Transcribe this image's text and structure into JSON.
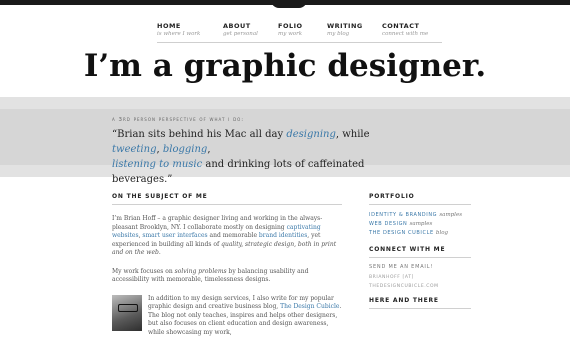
{
  "nav": [
    {
      "label": "HOME",
      "sub": "is where I work"
    },
    {
      "label": "ABOUT",
      "sub": "get personal"
    },
    {
      "label": "FOLIO",
      "sub": "my work"
    },
    {
      "label": "WRITING",
      "sub": "my blog"
    },
    {
      "label": "CONTACT",
      "sub": "connect with me"
    }
  ],
  "headline": "I’m a graphic designer.",
  "perspective_label": "A 3rd person perspective of what I do:",
  "quote": {
    "open": "“Brian sits behind his Mac all day ",
    "link1": "designing",
    "mid1": ", while ",
    "link2": "tweeting",
    "mid2": ", ",
    "link3": "blogging",
    "mid3": ",",
    "link4": "listening to music",
    "close": " and drinking lots of caffeinated beverages.”"
  },
  "main": {
    "section_title": "ON THE SUBJECT OF ME",
    "p1": {
      "t1": "I’m Brian Hoff – a graphic designer living and working in the always-pleasant Brooklyn, NY. I collaborate mostly on designing ",
      "l1": "captivating websites",
      "t2": ", ",
      "l2": "smart user interfaces",
      "t3": " and memorable ",
      "l3": "brand identities",
      "t4": ", yet experienced in building all kinds of ",
      "e1": "quality, strategic design, both in print and on the web."
    },
    "p2": {
      "t1": "My work focuses on ",
      "e1": "solving problems",
      "t2": " by balancing usability and accessibility with memorable, timelessness designs."
    },
    "p3": {
      "t1": "In addition to my design services, I also write for my popular graphic design and creative business blog, ",
      "l1": "The Design Cubicle",
      "t2": ". The blog not only teaches, inspires and helps other designers, but also focuses on client education and design awareness, while showcasing my work,"
    }
  },
  "side": {
    "portfolio_title": "PORTFOLIO",
    "portfolio_items": [
      {
        "link": "IDENTITY & BRANDING",
        "extra": "samples"
      },
      {
        "link": "WEB DESIGN",
        "extra": "samples"
      },
      {
        "link": "THE DESIGN CUBICLE",
        "extra": "blog"
      }
    ],
    "connect_title": "CONNECT WITH ME",
    "email_label": "SEND ME AN EMAIL!",
    "email_lines": [
      "BRIANHOFF [AT]",
      "THEDESIGNCUBICLE.COM"
    ],
    "here_title": "HERE AND THERE"
  },
  "colors": {
    "link": "#3a78a8",
    "band": "#d6d6d6",
    "topbar": "#1a1a1a"
  }
}
